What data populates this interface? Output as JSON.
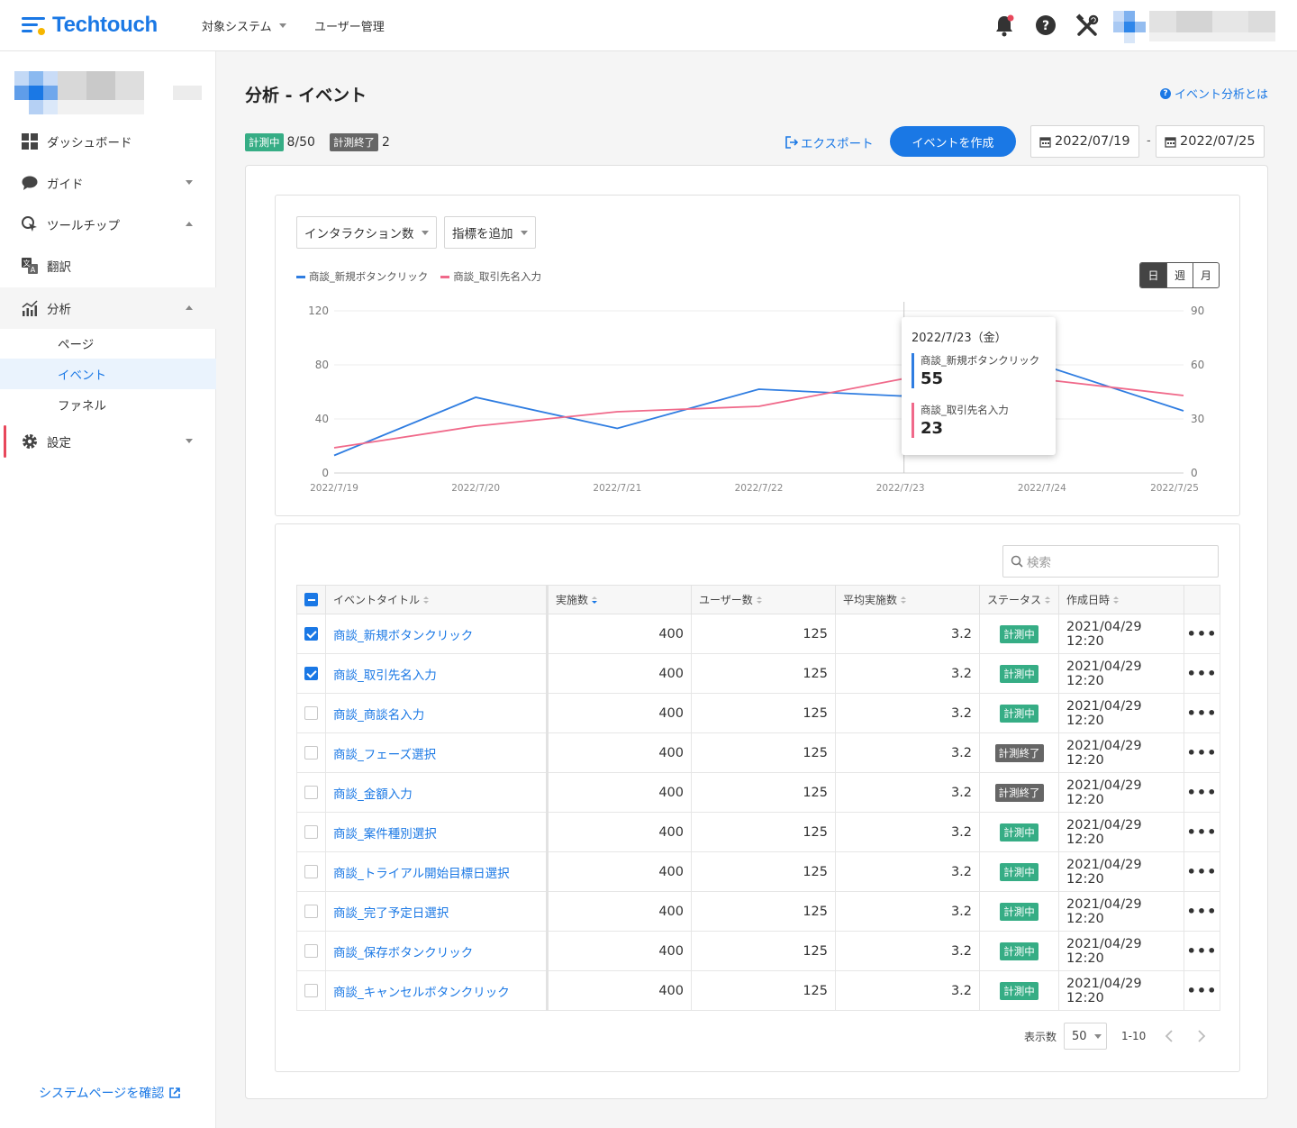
{
  "colors": {
    "accent": "#1a78e5",
    "series1": "#2f7de1",
    "series2": "#f0698a",
    "status_active": "#36ad85",
    "status_ended": "#666666",
    "side_marker": "#e8475b"
  },
  "header": {
    "logo_text": "Techtouch",
    "nav": [
      "対象システム",
      "ユーザー管理"
    ],
    "icons": [
      "bell-icon",
      "help-icon",
      "tools-icon"
    ]
  },
  "sidebar": {
    "items": [
      {
        "label": "ダッシュボード",
        "icon": "dashboard-icon"
      },
      {
        "label": "ガイド",
        "icon": "chat-bubble-icon"
      },
      {
        "label": "ツールチップ",
        "icon": "pointer-icon"
      },
      {
        "label": "翻訳",
        "icon": "translate-icon"
      },
      {
        "label": "分析",
        "icon": "analytics-icon"
      },
      {
        "label": "設定",
        "icon": "gear-icon"
      }
    ],
    "sub_items": [
      "ページ",
      "イベント",
      "ファネル"
    ],
    "footer_link": "システムページを確認"
  },
  "page": {
    "title": "分析 - イベント",
    "help_link": "イベント分析とは",
    "active_badge": "計測中",
    "active_count": "8/50",
    "ended_badge": "計測終了",
    "ended_count": "2",
    "export": "エクスポート",
    "create": "イベントを作成",
    "date_from": "2022/07/19",
    "date_dash": "-",
    "date_to": "2022/07/25"
  },
  "chart_panel": {
    "metric_select": "インタラクション数",
    "add_metric": "指標を追加",
    "period_buttons": [
      "日",
      "週",
      "月"
    ],
    "active_period": "日",
    "tooltip": {
      "date": "2022/7/23（金）",
      "entries": [
        {
          "name": "商談_新規ボタンクリック",
          "value": "55"
        },
        {
          "name": "商談_取引先名入力",
          "value": "23"
        }
      ]
    }
  },
  "chart_data": {
    "type": "line",
    "x": [
      "2022/7/19",
      "2022/7/20",
      "2022/7/21",
      "2022/7/22",
      "2022/7/23",
      "2022/7/24",
      "2022/7/25"
    ],
    "series": [
      {
        "name": "商談_新規ボタンクリック",
        "axis": "left",
        "values": [
          13,
          56,
          33,
          62,
          57,
          80,
          46
        ]
      },
      {
        "name": "商談_取引先名入力",
        "axis": "right",
        "values": [
          14,
          26,
          34,
          37,
          52,
          52,
          43
        ]
      }
    ],
    "ylim_left": [
      0,
      120
    ],
    "yticks_left": [
      0,
      40,
      80,
      120
    ],
    "ylim_right": [
      0,
      90
    ],
    "yticks_right": [
      0,
      30,
      60,
      90
    ],
    "legend_position": "top-left",
    "grid": true
  },
  "table": {
    "search_placeholder": "検索",
    "columns": [
      "イベントタイトル",
      "実施数",
      "ユーザー数",
      "平均実施数",
      "ステータス",
      "作成日時"
    ],
    "rows": [
      {
        "checked": true,
        "title": "商談_新規ボタンクリック",
        "count": "400",
        "users": "125",
        "avg": "3.2",
        "status": "計測中",
        "status_type": "active",
        "created": "2021/04/29 12:20"
      },
      {
        "checked": true,
        "title": "商談_取引先名入力",
        "count": "400",
        "users": "125",
        "avg": "3.2",
        "status": "計測中",
        "status_type": "active",
        "created": "2021/04/29 12:20"
      },
      {
        "checked": false,
        "title": "商談_商談名入力",
        "count": "400",
        "users": "125",
        "avg": "3.2",
        "status": "計測中",
        "status_type": "active",
        "created": "2021/04/29 12:20"
      },
      {
        "checked": false,
        "title": "商談_フェーズ選択",
        "count": "400",
        "users": "125",
        "avg": "3.2",
        "status": "計測終了",
        "status_type": "ended",
        "created": "2021/04/29 12:20"
      },
      {
        "checked": false,
        "title": "商談_金額入力",
        "count": "400",
        "users": "125",
        "avg": "3.2",
        "status": "計測終了",
        "status_type": "ended",
        "created": "2021/04/29 12:20"
      },
      {
        "checked": false,
        "title": "商談_案件種別選択",
        "count": "400",
        "users": "125",
        "avg": "3.2",
        "status": "計測中",
        "status_type": "active",
        "created": "2021/04/29 12:20"
      },
      {
        "checked": false,
        "title": "商談_トライアル開始目標日選択",
        "count": "400",
        "users": "125",
        "avg": "3.2",
        "status": "計測中",
        "status_type": "active",
        "created": "2021/04/29 12:20"
      },
      {
        "checked": false,
        "title": "商談_完了予定日選択",
        "count": "400",
        "users": "125",
        "avg": "3.2",
        "status": "計測中",
        "status_type": "active",
        "created": "2021/04/29 12:20"
      },
      {
        "checked": false,
        "title": "商談_保存ボタンクリック",
        "count": "400",
        "users": "125",
        "avg": "3.2",
        "status": "計測中",
        "status_type": "active",
        "created": "2021/04/29 12:20"
      },
      {
        "checked": false,
        "title": "商談_キャンセルボタンクリック",
        "count": "400",
        "users": "125",
        "avg": "3.2",
        "status": "計測中",
        "status_type": "active",
        "created": "2021/04/29 12:20"
      }
    ],
    "pagination": {
      "page_size_label": "表示数",
      "page_size": "50",
      "range": "1-10"
    }
  }
}
